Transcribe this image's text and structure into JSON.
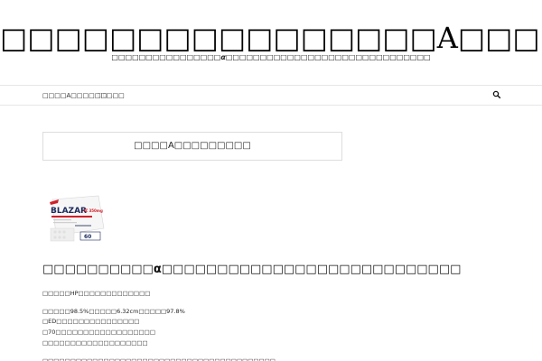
{
  "site": {
    "title": "□□□□□□□□□□□□□□□□A□□□□□□",
    "tagline": "□□□□□□□□□□□□□□□□α□□□□□□□□□□□□□□□□□□□□□□□□□□□□□□"
  },
  "nav": {
    "search_placeholder": "□□ ...",
    "menu_link": "□□□□A□□□□□□□□□"
  },
  "main": {
    "title_box": "□□□□A□□□□□□□□□",
    "heading": "□□□□□□□□□□α□□□□□□□□□□□□□□□□□□□□□□□□□□□",
    "paragraphs": [
      "□□□□□HP□□□□□□□□□□□□□",
      "□□□□□98.5%□□□□□6.32cm□□□□□97.8%",
      "□ED□□□□□□□□□□□□□□□",
      "□70□□□□□□□□□□□□□□□□□□",
      "□□□□□□□□□□□□□□□□□□□",
      "□□□□□□□□□□□□□□□□□□□□□□□□□□□□□□□□□□□□□□□□□□"
    ]
  },
  "product": {
    "brand": "BLAZAR",
    "variant": "-IZ 350mg",
    "pack_count": "60"
  },
  "colors": {
    "brand_red": "#d0202a",
    "text": "#111111",
    "border": "#dddddd"
  },
  "icons": {
    "search": "search-icon"
  }
}
